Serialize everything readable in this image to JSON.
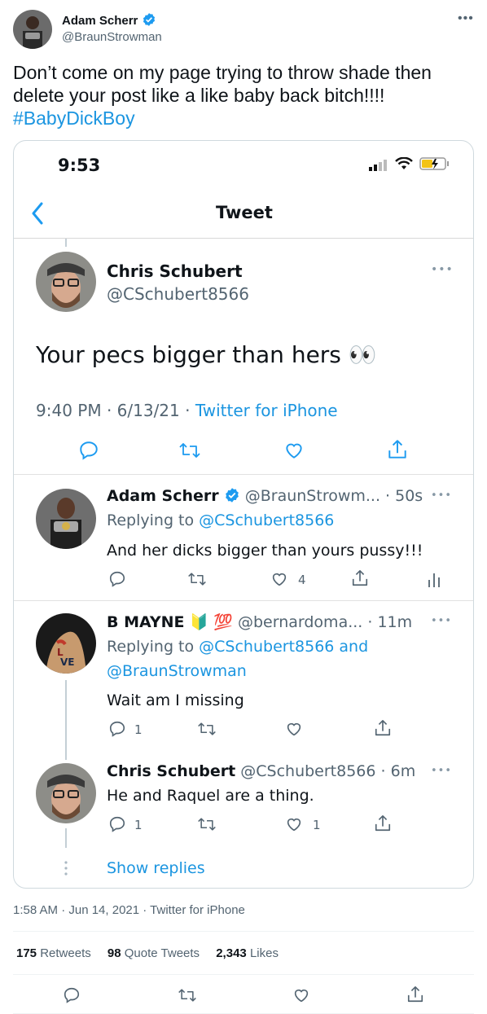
{
  "tweet": {
    "author_name": "Adam Scherr",
    "author_handle": "@BraunStrowman",
    "text": "Don’t come on my page trying to throw shade then delete your post like a like baby back bitch!!!!",
    "hashtag": "#BabyDickBoy",
    "timestamp": "1:58 AM · Jun 14, 2021 · Twitter for iPhone",
    "stats": {
      "retweets_count": "175",
      "retweets_label": "Retweets",
      "quotes_count": "98",
      "quotes_label": "Quote Tweets",
      "likes_count": "2,343",
      "likes_label": "Likes"
    }
  },
  "screenshot": {
    "status_time": "9:53",
    "nav_title": "Tweet",
    "main": {
      "name": "Chris Schubert",
      "handle": "@CSchubert8566",
      "text": "Your pecs bigger than hers 👀",
      "time": "9:40 PM · 6/13/21 · ",
      "source": "Twitter for iPhone"
    },
    "replies": [
      {
        "name": "Adam Scherr",
        "handle_time": "@BraunStrowm... · 50s",
        "replying_prefix": "Replying to ",
        "replying_to": "@CSchubert8566",
        "text": "And her dicks bigger than yours pussy!!!",
        "like_count": "4"
      },
      {
        "name": "B MAYNE",
        "emoji": "🔰 💯",
        "handle_time": "@bernardoma... · 11m",
        "replying_prefix": "Replying to ",
        "replying_to": "@CSchubert8566 and",
        "replying_to_2": "@BraunStrowman",
        "text": "Wait am I missing",
        "reply_count": "1"
      },
      {
        "name": "Chris Schubert",
        "handle_time": "@CSchubert8566 · 6m",
        "text": "He and Raquel are a thing.",
        "reply_count": "1",
        "like_count": "1"
      }
    ],
    "show_replies": "Show replies"
  },
  "colors": {
    "link": "#1b95e0",
    "verified": "#1d9bf0",
    "text": "#0f1419",
    "muted": "#536471"
  }
}
